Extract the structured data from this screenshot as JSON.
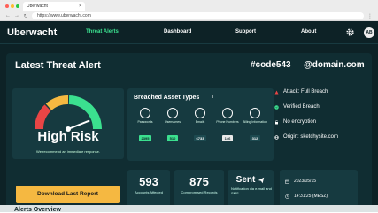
{
  "browser": {
    "tab_title": "Uberwacht",
    "tab_close": "×",
    "url": "https://www.uberwacht.com",
    "menu": "⋮"
  },
  "nav": {
    "brand": "Uberwacht",
    "links": [
      "Threat Alerts",
      "Dashboard",
      "Support",
      "About"
    ],
    "avatar": "AB"
  },
  "alert": {
    "title": "Latest Threat Alert",
    "code": "#code543",
    "domain": "@domain.com",
    "risk_level": "High Risk",
    "recommendation": "We recommend an immediate response.",
    "download_label": "Download Last Report",
    "gauge_fraction": 0.88
  },
  "assets": {
    "title": "Breached Asset Types",
    "info": "i",
    "items": [
      {
        "label": "Passwords",
        "count": "2395",
        "icon": "key-icon",
        "color": "#3be08f"
      },
      {
        "label": "Usernames",
        "count": "510",
        "icon": "users-icon",
        "color": "#3be08f"
      },
      {
        "label": "Emails",
        "count": "6733",
        "icon": "mail-icon",
        "color": "#1d4a50"
      },
      {
        "label": "Phone Numbers",
        "count": "146",
        "icon": "phone-icon",
        "color": "#e8e8e8"
      },
      {
        "label": "Billing Information",
        "count": "312",
        "icon": "billing-icon",
        "color": "#1d4a50"
      }
    ]
  },
  "stats": {
    "accounts_value": "593",
    "accounts_label": "Accounts Affected",
    "records_value": "875",
    "records_label": "Compromised Records",
    "sent_value": "Sent",
    "sent_label": "Notification via e-mail and SMS"
  },
  "date": {
    "date": "2023/05/15",
    "time": "14:31:25 (MESZ)"
  },
  "status": [
    {
      "label": "Attack: Full Breach",
      "icon": "warning-icon",
      "color": "#e84545"
    },
    {
      "label": "Verified Breach",
      "icon": "check-icon",
      "color": "#3be08f"
    },
    {
      "label": "No encryption",
      "icon": "no-encryption-icon",
      "color": "#ffffff"
    },
    {
      "label": "Origin: sketchysite.com",
      "icon": "globe-icon",
      "color": "#ffffff"
    }
  ],
  "below": {
    "heading": "Alerts Overview"
  }
}
